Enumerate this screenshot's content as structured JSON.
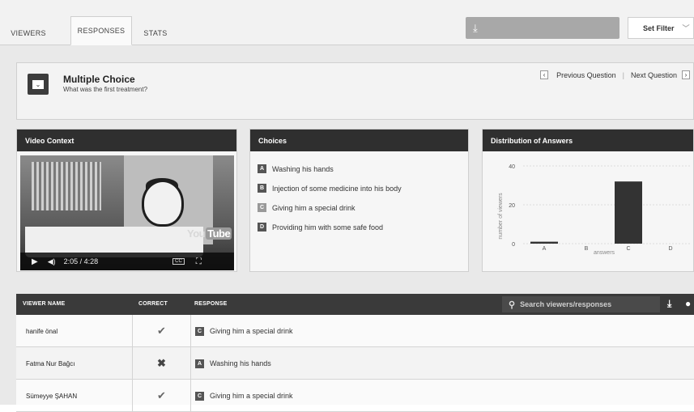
{
  "tabs": [
    {
      "label": "VIEWERS",
      "active": false
    },
    {
      "label": "RESPONSES",
      "active": true
    },
    {
      "label": "STATS",
      "active": false
    }
  ],
  "toolbar": {
    "download_icon": "download-icon",
    "set_filter_label": "Set Filter"
  },
  "question": {
    "type_label": "Multiple Choice",
    "text": "What was the first treatment?",
    "prev_label": "Previous Question",
    "next_label": "Next Question"
  },
  "video_card": {
    "title": "Video Context",
    "time": "2:05 / 4:28",
    "watermark_a": "You",
    "watermark_b": "Tube",
    "cc_label": "CC"
  },
  "choices_card": {
    "title": "Choices",
    "items": [
      {
        "letter": "A",
        "text": "Washing his hands"
      },
      {
        "letter": "B",
        "text": "Injection of some medicine into his body"
      },
      {
        "letter": "C",
        "text": "Giving him a special drink"
      },
      {
        "letter": "D",
        "text": "Providing him with some safe food"
      }
    ]
  },
  "distribution_card": {
    "title": "Distribution of Answers"
  },
  "chart_data": {
    "type": "bar",
    "categories": [
      "A",
      "B",
      "C",
      "D"
    ],
    "values": [
      1,
      0,
      32,
      0
    ],
    "xlabel": "answers",
    "ylabel": "number of viewers",
    "yticks": [
      0,
      20,
      40
    ],
    "ylim": [
      0,
      40
    ],
    "grid": true
  },
  "table": {
    "headers": {
      "name": "VIEWER NAME",
      "correct": "CORRECT",
      "response": "RESPONSE"
    },
    "search_placeholder": "Search viewers/responses",
    "rows": [
      {
        "name": "hanife önal",
        "correct": true,
        "letter": "C",
        "response": "Giving him a special drink"
      },
      {
        "name": "Fatma Nur Bağcı",
        "correct": false,
        "letter": "A",
        "response": "Washing his hands"
      },
      {
        "name": "Sümeyye ŞAHAN",
        "correct": true,
        "letter": "C",
        "response": "Giving him a special drink"
      }
    ]
  }
}
